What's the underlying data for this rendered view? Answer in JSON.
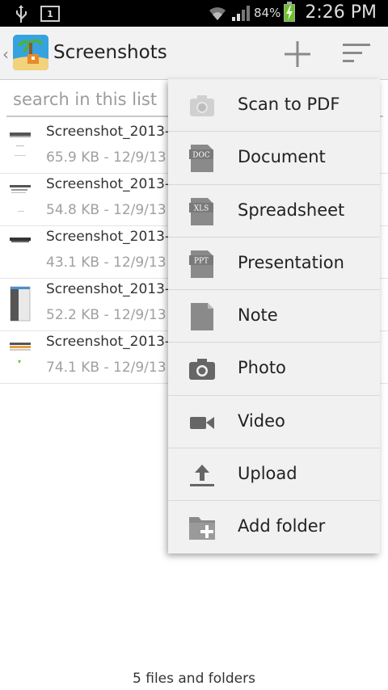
{
  "status_bar": {
    "notification_count": "1",
    "battery": "84%",
    "time": "2:26 PM"
  },
  "action_bar": {
    "title": "Screenshots",
    "icons": [
      "back-chevron-icon",
      "app-logo",
      "add-icon",
      "sort-icon"
    ]
  },
  "search": {
    "placeholder": "search in this list"
  },
  "files": [
    {
      "name": "Screenshot_2013-",
      "meta": "65.9 KB - 12/9/13"
    },
    {
      "name": "Screenshot_2013-",
      "meta": "54.8 KB - 12/9/13"
    },
    {
      "name": "Screenshot_2013-",
      "meta": "43.1 KB - 12/9/13"
    },
    {
      "name": "Screenshot_2013-",
      "meta": "52.2 KB - 12/9/13"
    },
    {
      "name": "Screenshot_2013-",
      "meta": "74.1 KB - 12/9/13"
    }
  ],
  "footer": "5 files and folders",
  "menu": {
    "items": [
      {
        "label": "Scan to PDF",
        "icon": "camera-scan-icon"
      },
      {
        "label": "Document",
        "icon": "doc-file-icon",
        "badge": "DOC"
      },
      {
        "label": "Spreadsheet",
        "icon": "xls-file-icon",
        "badge": "XLS"
      },
      {
        "label": "Presentation",
        "icon": "ppt-file-icon",
        "badge": "PPT"
      },
      {
        "label": "Note",
        "icon": "note-file-icon"
      },
      {
        "label": "Photo",
        "icon": "camera-icon"
      },
      {
        "label": "Video",
        "icon": "video-camera-icon"
      },
      {
        "label": "Upload",
        "icon": "upload-icon"
      },
      {
        "label": "Add folder",
        "icon": "add-folder-icon"
      }
    ]
  },
  "colors": {
    "action_bar_bg": "#f2f2f2",
    "menu_bg": "#f1f1f1",
    "battery_green": "#6cc12a",
    "logo_blue": "#36a3e0"
  }
}
